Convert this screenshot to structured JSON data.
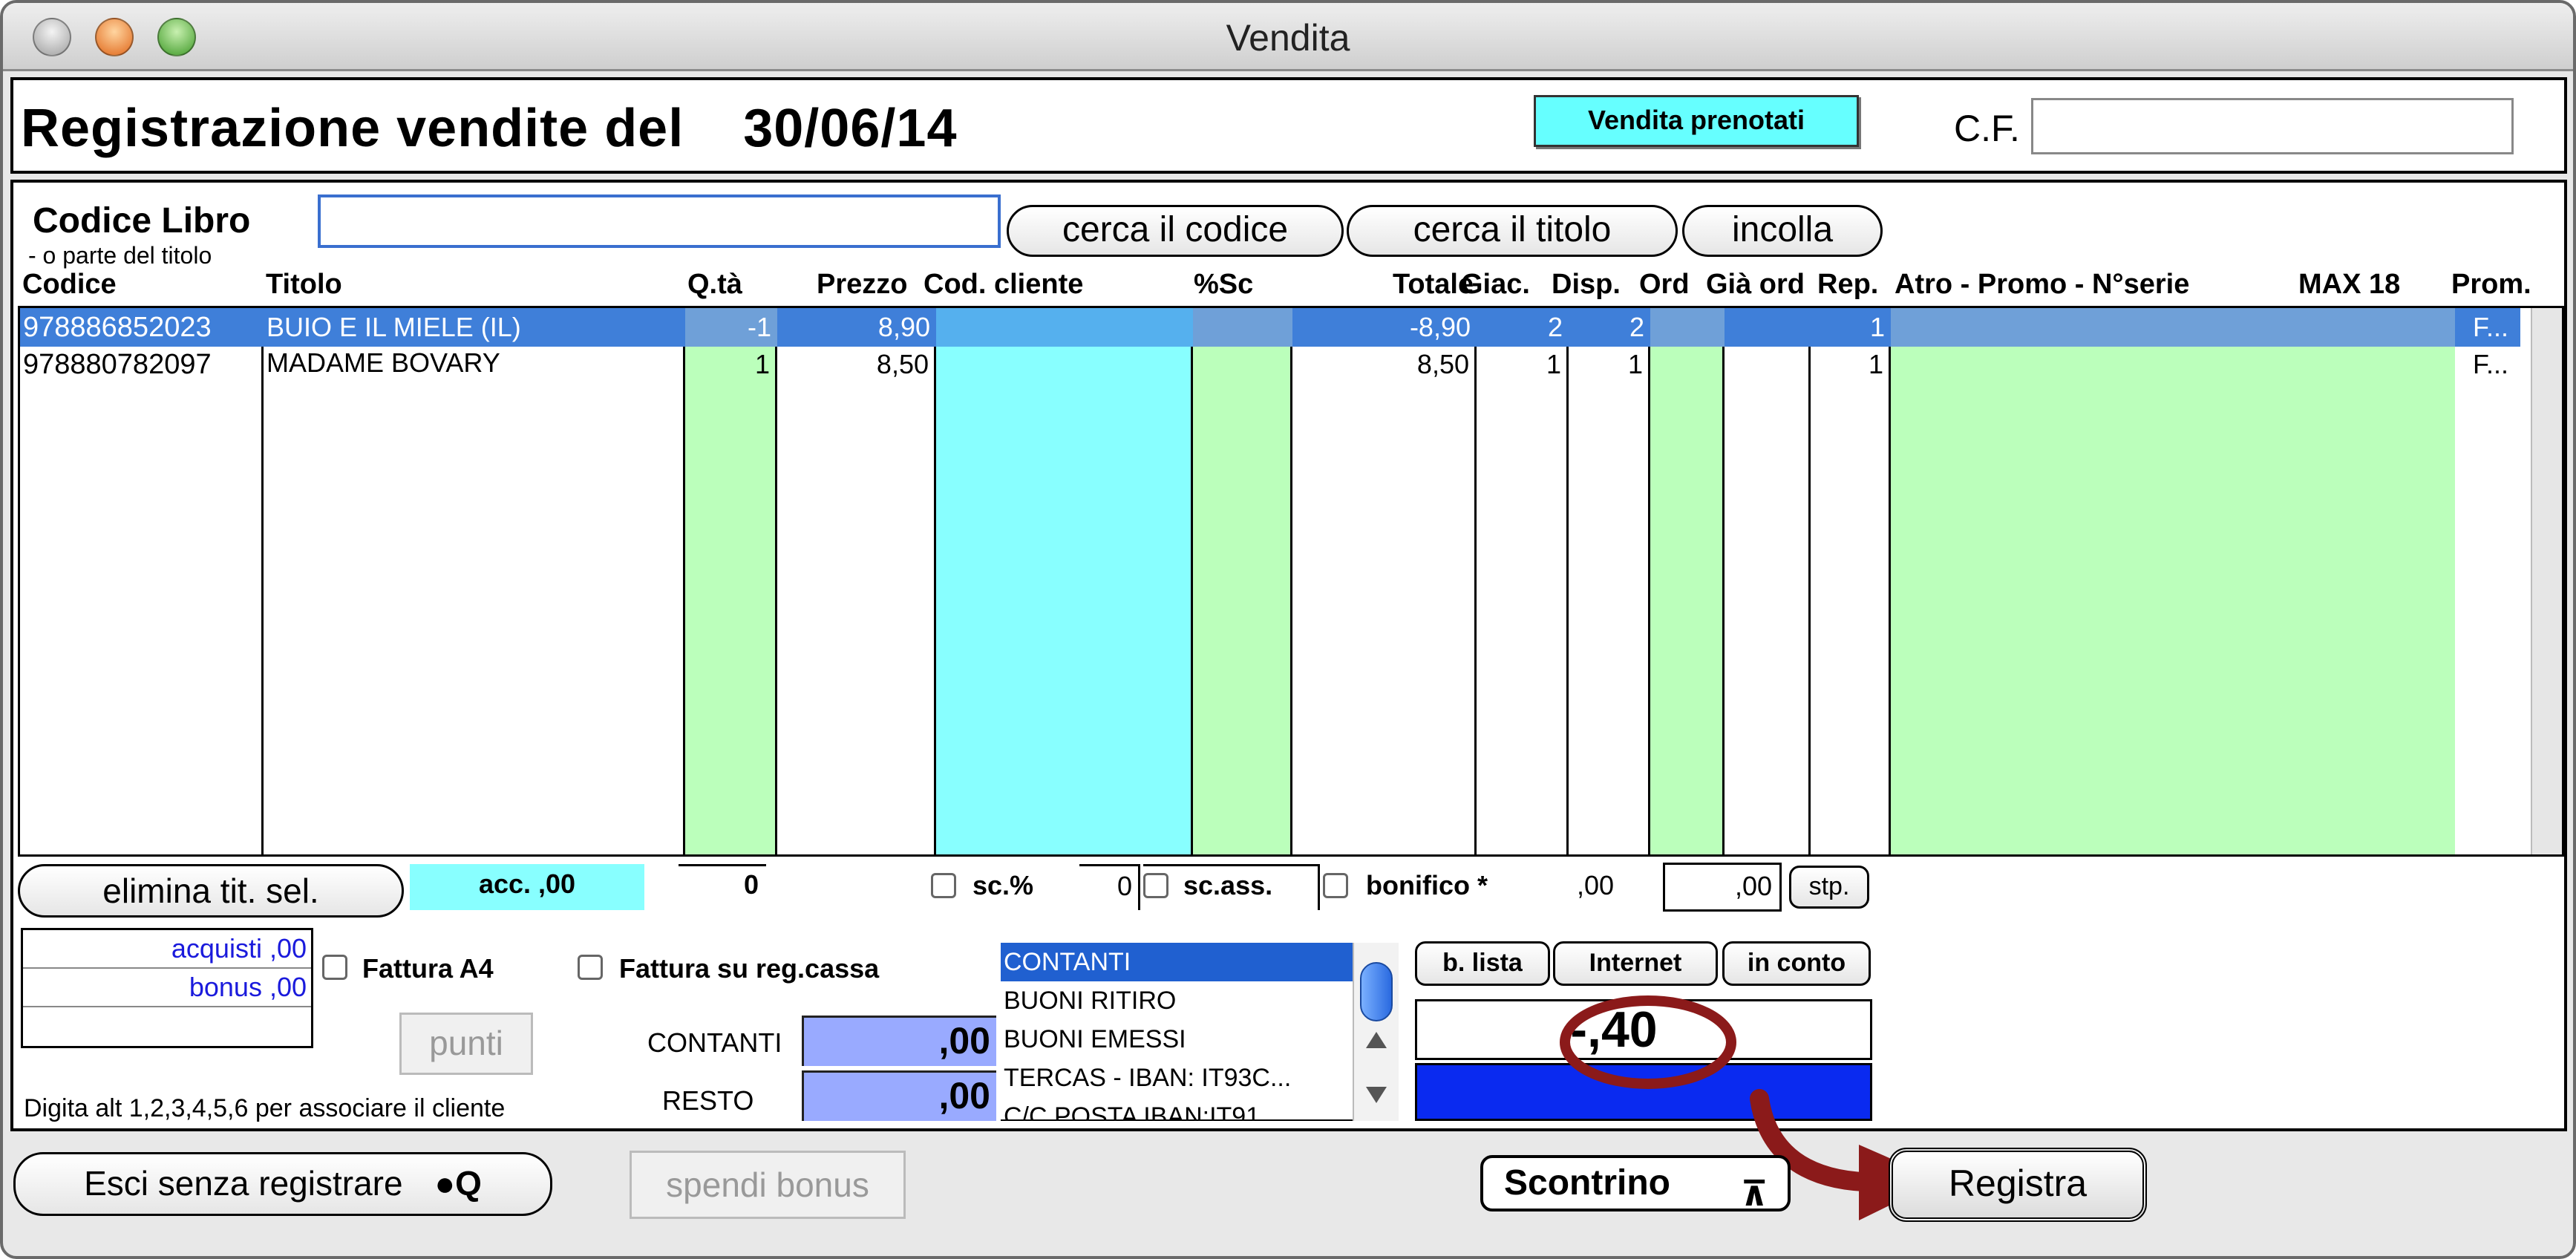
{
  "window": {
    "title": "Vendita"
  },
  "header": {
    "title": "Registrazione vendite del",
    "date": "30/06/14",
    "vendita_prenotati_button": "Vendita prenotati",
    "cf_label": "C.F.",
    "cf_value": ""
  },
  "search": {
    "label": "Codice Libro",
    "hint": "- o parte del  titolo",
    "value": "",
    "buttons": {
      "cerca_codice": "cerca il codice",
      "cerca_titolo": "cerca il titolo",
      "incolla": "incolla"
    }
  },
  "table": {
    "columns": [
      "Codice",
      "Titolo",
      "Q.tà",
      "Prezzo",
      "Cod. cliente",
      "%Sc",
      "Totale",
      "Giac.",
      "Disp.",
      "Ord",
      "Già ord",
      "Rep.",
      "Atro - Promo - N°serie",
      "MAX 18",
      "Prom."
    ],
    "rows": [
      {
        "codice": "978886852023",
        "titolo": "BUIO E IL MIELE (IL)",
        "qta": "-1",
        "prezzo": "8,90",
        "totale": "-8,90",
        "giac": "2",
        "disp": "2",
        "rep": "1",
        "prom": "F..."
      },
      {
        "codice": "978880782097",
        "titolo": "MADAME BOVARY",
        "qta": "1",
        "prezzo": "8,50",
        "totale": "8,50",
        "giac": "1",
        "disp": "1",
        "rep": "1",
        "prom": "F..."
      }
    ]
  },
  "footer_row": {
    "elimina": "elimina tit. sel.",
    "acc": "acc. ,00",
    "qty_total": "0",
    "sc_pct_label": "sc.%",
    "sc_pct_value": "0",
    "sc_ass_label": "sc.ass.",
    "bonifico_label": "bonifico *",
    "bonifico_value": ",00",
    "field2_value": ",00",
    "stp": "stp."
  },
  "customer": {
    "acquisti": "acquisti ,00",
    "bonus": "bonus ,00",
    "fattura_a4": "Fattura A4",
    "fattura_reg": "Fattura su reg.cassa",
    "punti": "punti",
    "hint": "Digita alt 1,2,3,4,5,6 per associare il cliente"
  },
  "payment": {
    "contanti_label": "CONTANTI",
    "contanti_value": ",00",
    "resto_label": "RESTO",
    "resto_value": ",00",
    "methods": [
      "CONTANTI",
      "BUONI RITIRO",
      "BUONI EMESSI",
      "TERCAS - IBAN: IT93C...",
      "C/C POSTA IBAN:IT91"
    ],
    "b_lista": "b. lista",
    "internet": "Internet",
    "in_conto": "in conto",
    "total": "-,40"
  },
  "bottom": {
    "esci": "Esci senza registrare",
    "esci_shortcut": "Q",
    "spendi_bonus": "spendi bonus",
    "scontrino": "Scontrino",
    "registra": "Registra"
  },
  "colors": {
    "cyan": "#66ffff",
    "green": "#bbffbb",
    "selection": "#3f7fd9",
    "annotation": "#8b1a1a"
  }
}
